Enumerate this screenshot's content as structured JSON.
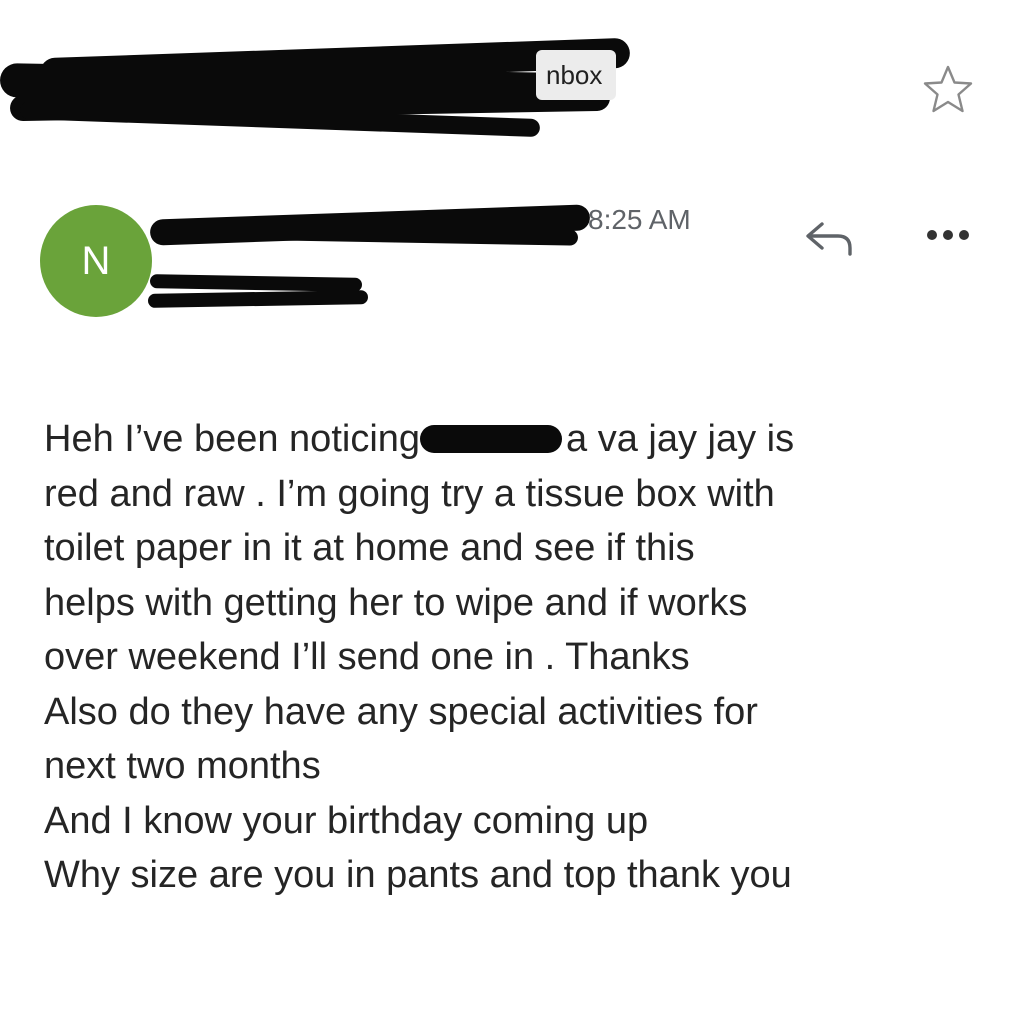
{
  "header": {
    "label": "nbox"
  },
  "sender": {
    "avatar_initial": "N",
    "time": "8:25 AM",
    "avatar_color": "#6aa33a"
  },
  "icons": {
    "star": "star-icon",
    "reply": "reply-icon",
    "more": "more-icon"
  },
  "message": {
    "line1_start": "Heh I’ve been noticing",
    "line1_end": "a va jay jay is",
    "line2": "red and raw . I’m going try a tissue box with",
    "line3": "toilet paper in it at home and see if this",
    "line4": "helps with getting her to wipe and if works",
    "line5": "over weekend I’ll send one in . Thanks",
    "line6": "Also do they have any special activities for",
    "line7": "next two months",
    "line8": "And I know your birthday coming up",
    "line9": "Why size are you in pants and top thank you"
  }
}
